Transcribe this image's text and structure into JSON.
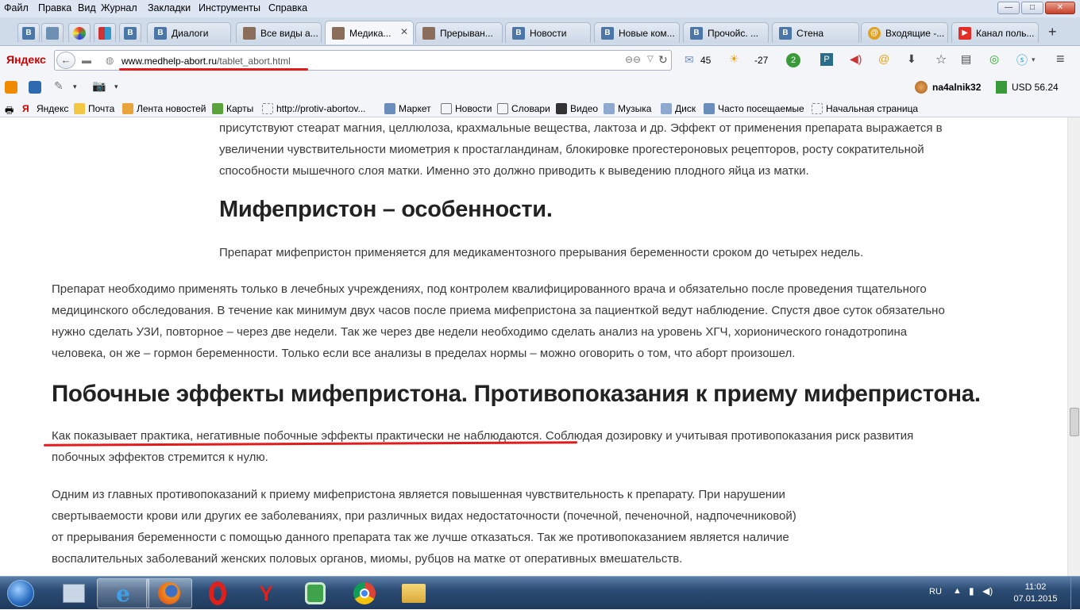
{
  "menu": {
    "items": [
      "Файл",
      "Правка",
      "Вид",
      "Журнал",
      "Закладки",
      "Инструменты",
      "Справка"
    ]
  },
  "window_controls": {
    "minimize": "—",
    "maximize": "□",
    "close": "✕"
  },
  "tabs": [
    {
      "label": "Диалоги",
      "icon": "vk-icon"
    },
    {
      "label": "Все виды а...",
      "icon": "medhelp-icon"
    },
    {
      "label": "Медика...",
      "icon": "medhelp-icon",
      "active": true
    },
    {
      "label": "Прерыван...",
      "icon": "medhelp-icon"
    },
    {
      "label": "Новости",
      "icon": "vk-icon"
    },
    {
      "label": "Новые ком...",
      "icon": "vk-icon"
    },
    {
      "label": "Прочойс. ...",
      "icon": "vk-icon"
    },
    {
      "label": "Стена",
      "icon": "vk-icon"
    },
    {
      "label": "Входящие -...",
      "icon": "mail-icon"
    },
    {
      "label": "Канал поль...",
      "icon": "youtube-icon"
    }
  ],
  "pinned_tabs": [
    "В",
    "В",
    "В"
  ],
  "nav": {
    "brand": "Яндекс",
    "url_domain": "www.medhelp-abort.ru",
    "url_path": "/tablet_abort.html",
    "mail_count": "45",
    "weather": "-27",
    "badge_count": "2"
  },
  "toolbar2": {
    "username": "na4alnik32",
    "currency": "USD 56.24"
  },
  "bookmarks": [
    "Яндекс",
    "Почта",
    "Лента новостей",
    "Карты",
    "http://protiv-abortov...",
    "Маркет",
    "Новости",
    "Словари",
    "Видео",
    "Музыка",
    "Диск",
    "Часто посещаемые",
    "Начальная страница"
  ],
  "article": {
    "p1_lines": [
      "присутствуют стеарат магния, целлюлоза, крахмальные вещества, лактоза и др. Эффект от применения препарата выражается в",
      "увеличении чувствительности миометрия к простагландинам, блокировке прогестероновых рецепторов, росту сократительной",
      "способности мышечного слоя матки. Именно это должно приводить к выведению плодного яйца из матки."
    ],
    "h2": "Мифепристон – особенности.",
    "p2": "Препарат мифепристон применяется для медикаментозного прерывания беременности сроком до четырех недель.",
    "p3_lines": [
      "Препарат необходимо применять только в лечебных учреждениях, под контролем квалифицированного врача и обязательно после проведения тщательного",
      "медицинского обследования. В течение как минимум двух часов после приема мифепристона за пациенткой ведут наблюдение. Спустя двое суток обязательно",
      "нужно сделать УЗИ, повторное – через две недели. Так же через две недели необходимо сделать анализ на уровень ХГЧ, хорионического гонадотропина",
      "человека, он же – гормон беременности. Только если все анализы в пределах нормы – можно оговорить о том, что аборт произошел."
    ],
    "h1": "Побочные эффекты мифепристона. Противопоказания к приему мифепристона.",
    "p4_lines": [
      "Как показывает практика, негативные побочные эффекты практически не наблюдаются. Соблюдая дозировку и учитывая противопоказания риск развития",
      "побочных эффектов стремится к нулю."
    ],
    "p5_lines": [
      "Одним из главных противопоказаний к приему мифепристона является повышенная чувствительность к препарату. При нарушении",
      "свертываемости крови или других ее заболеваниях, при различных видах недостаточности (почечной, печеночной, надпочечниковой)",
      "от прерывания беременности с помощью данного препарата так же лучше отказаться. Так же противопоказанием является наличие",
      "воспалительных заболеваний женских половых органов, миомы, рубцов на матке от оперативных вмешательств."
    ]
  },
  "taskbar": {
    "apps": [
      "start-orb",
      "pinned-app",
      "internet-explorer",
      "firefox",
      "opera",
      "yandex-browser",
      "evernote",
      "chrome",
      "file-explorer"
    ],
    "lang": "RU",
    "time": "11:02",
    "date": "07.01.2015"
  },
  "colors": {
    "highlight_line": "#e21c1c",
    "vk_blue": "#4a76a8",
    "taskbar": "#2c4c74"
  }
}
